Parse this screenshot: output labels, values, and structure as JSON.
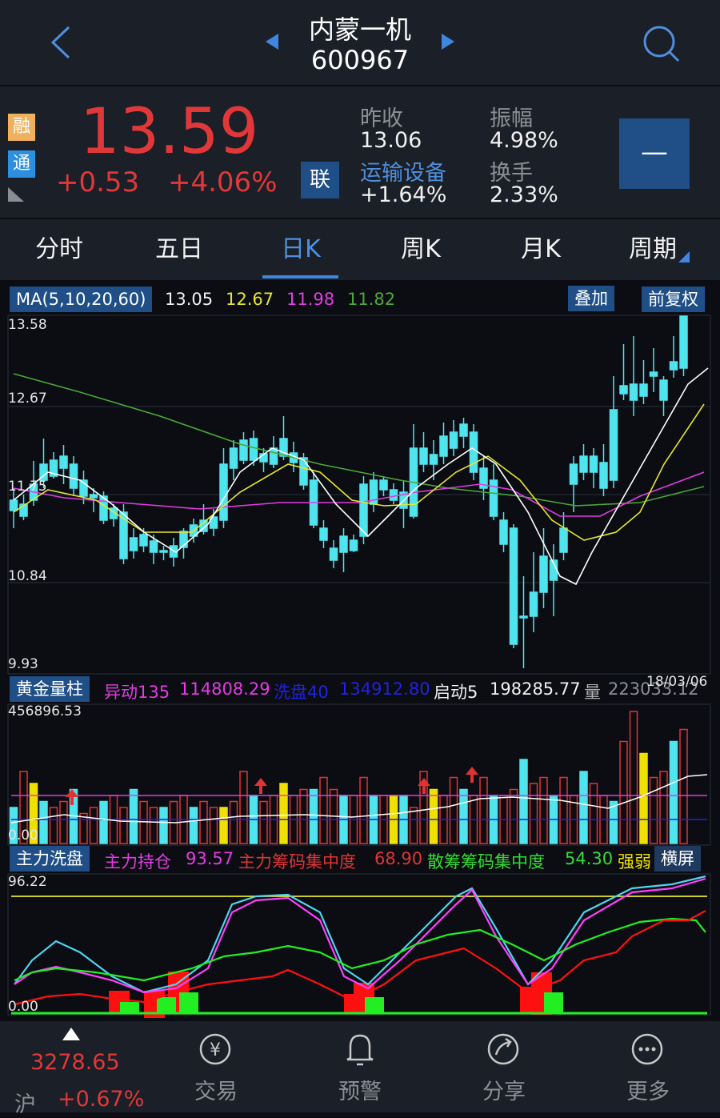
{
  "header": {
    "stock_name": "内蒙一机",
    "stock_code": "600967"
  },
  "quote": {
    "badge_rong": "融",
    "badge_tong": "通",
    "price": "13.59",
    "change": "+0.53",
    "change_pct": "+4.06%",
    "lian": "联",
    "prev_close_label": "昨收",
    "prev_close": "13.06",
    "sector_name": "运输设备",
    "sector_change": "+1.64%",
    "amplitude_label": "振幅",
    "amplitude": "4.98%",
    "turnover_label": "换手",
    "turnover": "2.33%",
    "minus_button": "—"
  },
  "tabs": {
    "items": [
      "分时",
      "五日",
      "日K",
      "周K",
      "月K",
      "周期"
    ],
    "active": "日K"
  },
  "main_chart": {
    "ma_label": "MA(5,10,20,60)",
    "ma5": "13.05",
    "ma10": "12.67",
    "ma20": "11.98",
    "ma60": "11.82",
    "overlay_button": "叠加",
    "fq_button": "前复权",
    "y_ticks": [
      "13.58",
      "12.67",
      "11.75",
      "10.84",
      "9.93"
    ],
    "colors": {
      "ma5": "#ffffff",
      "ma10": "#e6e62e",
      "ma20": "#e23ce2",
      "ma60": "#4aa83a",
      "up": "#e03434",
      "down": "#4fe4ee"
    }
  },
  "volume_panel": {
    "title": "黄金量柱",
    "yidong_label": "异动135",
    "yidong_value": "114808.29",
    "xipan_label": "洗盘40",
    "xipan_value": "134912.80",
    "qidong_label": "启动5",
    "qidong_value": "198285.77",
    "liang_label": "量",
    "liang_value": "223033.12",
    "date": "18/03/06",
    "y_top": "456896.53",
    "y_bottom": "0.00"
  },
  "wash_panel": {
    "title": "主力洗盘",
    "hold_label": "主力持仓",
    "hold_value": "93.57",
    "conc_label": "主力筹码集中度",
    "conc_value": "68.90",
    "retail_label": "散筹筹码集中度",
    "retail_value": "54.30",
    "strength": "强弱",
    "landscape_button": "横屏",
    "y_top": "96.22",
    "y_bottom": "0.00"
  },
  "bottom_nav": {
    "index_value": "3278.65",
    "index_name": "沪",
    "index_change": "+0.67%",
    "trade": "交易",
    "alert": "预警",
    "share": "分享",
    "more": "更多"
  }
}
